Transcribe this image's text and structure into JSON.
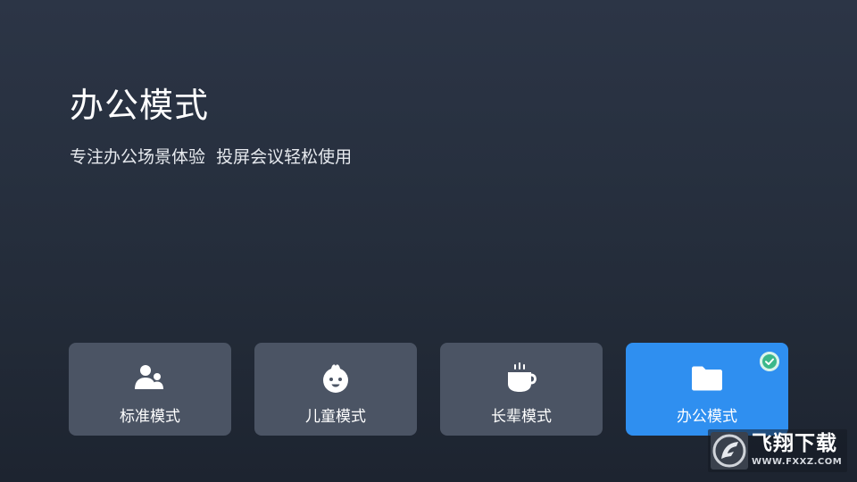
{
  "page": {
    "title": "办公模式",
    "subtitle": "专注办公场景体验  投屏会议轻松使用"
  },
  "modes": [
    {
      "label": "标准模式",
      "icon": "users-icon",
      "selected": false
    },
    {
      "label": "儿童模式",
      "icon": "baby-face-icon",
      "selected": false
    },
    {
      "label": "长辈模式",
      "icon": "tea-cup-icon",
      "selected": false
    },
    {
      "label": "办公模式",
      "icon": "folder-icon",
      "selected": true
    }
  ],
  "watermark": {
    "brand": "飞翔下载",
    "url": "WWW.FXXZ.COM"
  },
  "colors": {
    "background_top": "#2c3546",
    "background_bottom": "#1d2430",
    "card": "#4b5464",
    "card_selected": "#2f8ff0",
    "check_badge": "#d9f3ea",
    "check_mark": "#3bb88a"
  }
}
